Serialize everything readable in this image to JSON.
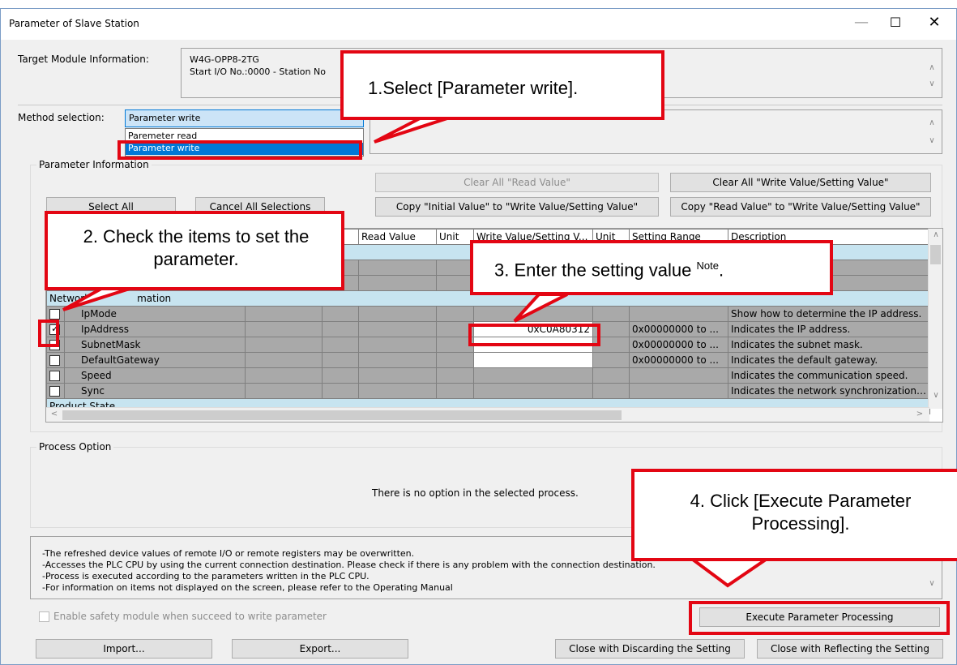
{
  "window": {
    "title": "Parameter of Slave Station"
  },
  "target": {
    "label": "Target Module Information:",
    "line1": "W4G-OPP8-2TG",
    "line2": "Start I/O No.:0000 - Station No"
  },
  "method": {
    "label": "Method selection:",
    "selected": "Parameter write",
    "options": [
      "Paremeter read",
      "Parameter write"
    ]
  },
  "param_info": {
    "title": "Parameter Information",
    "clear_read": "Clear All \"Read Value\"",
    "clear_write": "Clear All \"Write Value/Setting Value\"",
    "select_all": "Select All",
    "cancel_all": "Cancel All Selections",
    "copy_initial": "Copy \"Initial Value\" to \"Write Value/Setting Value\"",
    "copy_read": "Copy \"Read Value\" to \"Write Value/Setting Value\""
  },
  "table": {
    "headers": [
      "Read Value",
      "Unit",
      "Write Value/Setting V...",
      "Unit",
      "Setting Range",
      "Description"
    ],
    "category_network": "Network",
    "category_network_tail": "mation",
    "category_product": "Product State",
    "rows": [
      {
        "name": "IpMode",
        "checked": false,
        "write": "",
        "range": "",
        "desc": "Show how to determine the IP address."
      },
      {
        "name": "IpAddress",
        "checked": true,
        "write": "0xC0A80312",
        "range": "0x00000000 to ...",
        "desc": "Indicates the IP address."
      },
      {
        "name": "SubnetMask",
        "checked": false,
        "write": "",
        "range": "0x00000000 to ...",
        "desc": "Indicates the subnet mask."
      },
      {
        "name": "DefaultGateway",
        "checked": false,
        "write": "",
        "range": "0x00000000 to ...",
        "desc": "Indicates the default gateway."
      },
      {
        "name": "Speed",
        "checked": false,
        "write": "",
        "range": "",
        "desc": "Indicates the communication speed."
      },
      {
        "name": "Sync",
        "checked": false,
        "write": "",
        "range": "",
        "desc": "Indicates the network synchronization st..."
      }
    ]
  },
  "process": {
    "title": "Process Option",
    "empty": "There is no option in the selected process."
  },
  "notes": [
    "-The refreshed device values of remote I/O or remote registers may be overwritten.",
    "-Accesses the PLC CPU by using the current connection destination. Please check if there is any problem with the connection destination.",
    "-Process is executed according to the parameters written in the PLC CPU.",
    "-For information on items not displayed on the screen, please refer to the Operating Manual"
  ],
  "safety": "Enable safety module when succeed to write parameter",
  "buttons": {
    "execute": "Execute Parameter Processing",
    "import": "Import...",
    "export": "Export...",
    "close_discard": "Close with Discarding the Setting",
    "close_reflect": "Close with Reflecting the Setting"
  },
  "callouts": {
    "c1": "1.Select [Parameter write].",
    "c2": "2. Check the items to set the parameter.",
    "c3": "3. Enter the setting value",
    "c3_sup": "Note",
    "c3_end": ".",
    "c4": "4. Click [Execute Parameter Processing]."
  },
  "colors": {
    "highlight_red": "#e30613",
    "selection_blue": "#0078d7",
    "category_blue": "#c7e4f0"
  }
}
